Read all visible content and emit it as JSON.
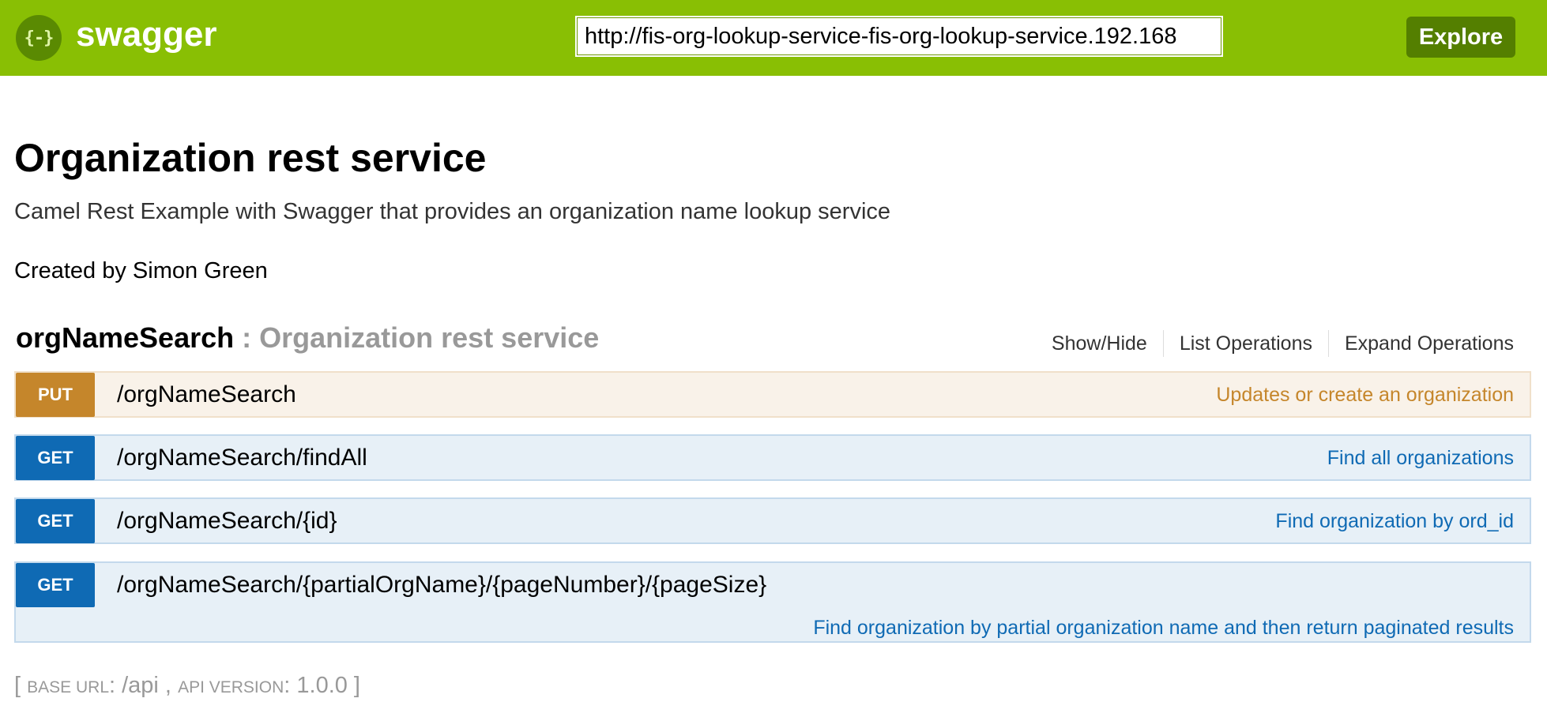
{
  "header": {
    "logo_glyph": "{-}",
    "brand": "swagger",
    "url_value": "http://fis-org-lookup-service-fis-org-lookup-service.192.168",
    "explore_label": "Explore",
    "colors": {
      "bar": "#89bf04",
      "explore_button": "#547f00"
    }
  },
  "info": {
    "title": "Organization rest service",
    "description": "Camel Rest Example with Swagger that provides an organization name lookup service",
    "created_by": "Created by Simon Green"
  },
  "resource": {
    "name": "orgNameSearch",
    "separator": " : ",
    "description": "Organization rest service",
    "actions": {
      "show_hide": "Show/Hide",
      "list_operations": "List Operations",
      "expand_operations": "Expand Operations"
    }
  },
  "operations": [
    {
      "method": "PUT",
      "path": "/orgNameSearch",
      "summary": "Updates or create an organization",
      "color": "#c5862b"
    },
    {
      "method": "GET",
      "path": "/orgNameSearch/findAll",
      "summary": "Find all organizations",
      "color": "#0f6ab4"
    },
    {
      "method": "GET",
      "path": "/orgNameSearch/{id}",
      "summary": "Find organization by ord_id",
      "color": "#0f6ab4"
    },
    {
      "method": "GET",
      "path": "/orgNameSearch/{partialOrgName}/{pageNumber}/{pageSize}",
      "summary": "Find organization by partial organization name and then return paginated results",
      "color": "#0f6ab4"
    }
  ],
  "footer": {
    "open_bracket": "[ ",
    "base_url_label": "Base URL",
    "base_url_value": ": /api ,",
    "api_version_label": "API Version",
    "api_version_value": ": 1.0.0 ]"
  }
}
